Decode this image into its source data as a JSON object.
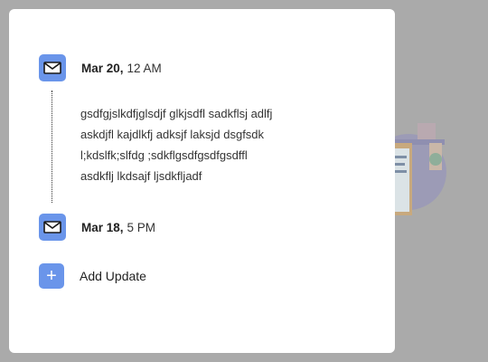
{
  "timeline": {
    "entries": [
      {
        "date": "Mar 20,",
        "time": "12 AM",
        "icon": "envelope-icon",
        "lines": [
          "gsdfgjslkdfjglsdjf glkjsdfl sadkflsj adlfj",
          "askdjfl kajdlkfj adksjf laksjd dsgfsdk",
          "l;kdslfk;slfdg ;sdkflgsdfgsdfgsdffl",
          "asdkflj lkdsajf ljsdkfljadf"
        ]
      },
      {
        "date": "Mar 18,",
        "time": "5 PM",
        "icon": "envelope-icon",
        "lines": []
      }
    ],
    "add_update_label": "Add Update"
  },
  "colors": {
    "accent": "#6a95ea",
    "overlay": "#aaaaaa"
  }
}
